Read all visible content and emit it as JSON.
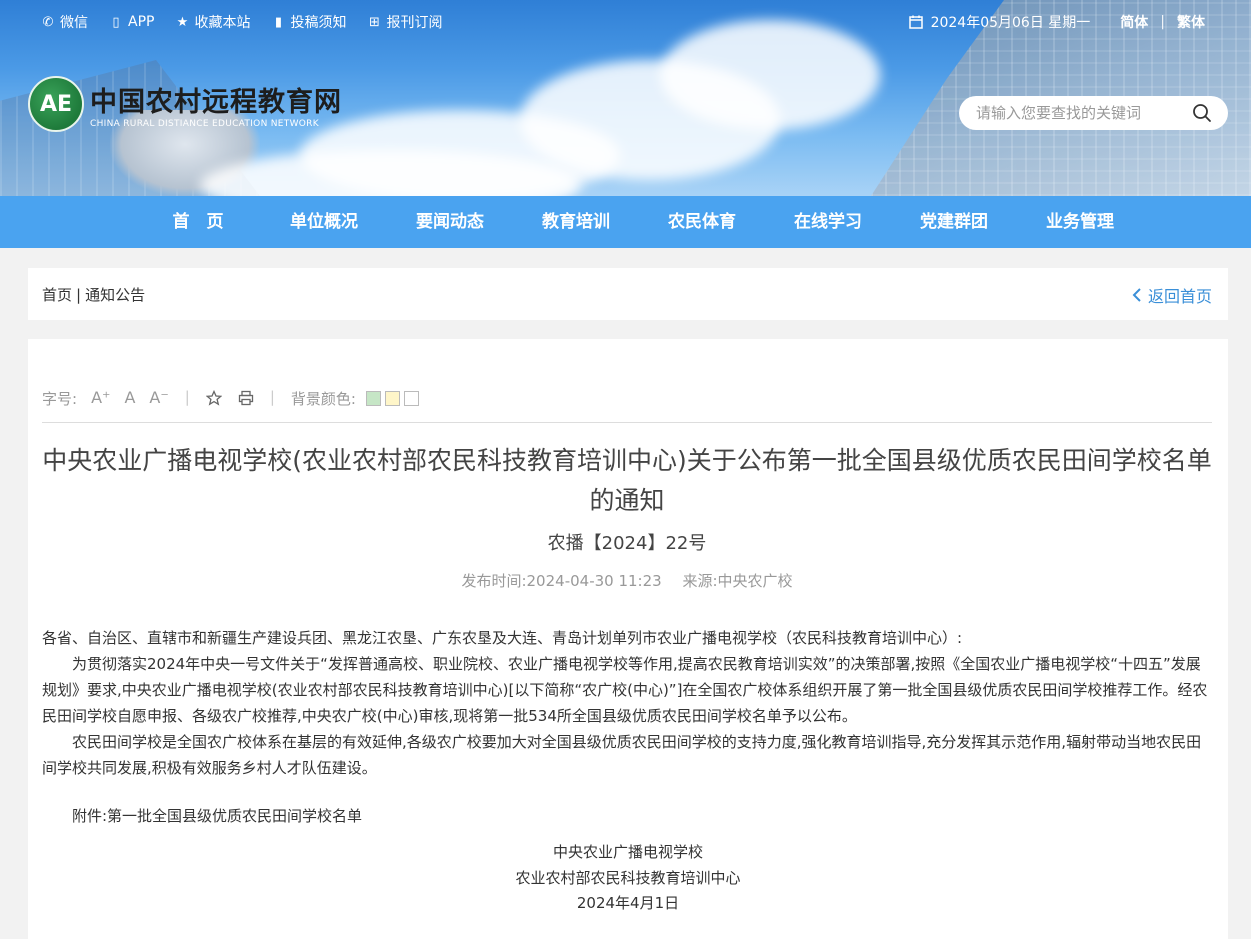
{
  "topbar": {
    "links": [
      {
        "icon": "wechat-icon",
        "glyph": "✆",
        "label": "微信"
      },
      {
        "icon": "phone-icon",
        "glyph": "▯",
        "label": "APP"
      },
      {
        "icon": "star-icon",
        "glyph": "★",
        "label": "收藏本站"
      },
      {
        "icon": "bar-chart-icon",
        "glyph": "▮",
        "label": "投稿须知"
      },
      {
        "icon": "plus-square-icon",
        "glyph": "⊞",
        "label": "报刊订阅"
      }
    ],
    "date": "2024年05月06日 星期一",
    "lang_simplified": "简体",
    "lang_separator": "|",
    "lang_traditional": "繁体"
  },
  "logo": {
    "mark": "AE",
    "cn": "中国农村远程教育网",
    "en": "CHINA RURAL DISTIANCE EDUCATION NETWORK"
  },
  "search": {
    "placeholder": "请输入您要查找的关键词"
  },
  "nav": [
    "首　页",
    "单位概况",
    "要闻动态",
    "教育培训",
    "农民体育",
    "在线学习",
    "党建群团",
    "业务管理"
  ],
  "breadcrumb": {
    "home": "首页",
    "sep": "|",
    "current": "通知公告",
    "back": "返回首页"
  },
  "tools": {
    "font_label": "字号:",
    "font_larger": "A⁺",
    "font_normal": "A",
    "font_smaller": "A⁻",
    "bg_label": "背景颜色:",
    "swatches": [
      "#c6e6c6",
      "#fff6c9",
      "#ffffff"
    ]
  },
  "article": {
    "title": "中央农业广播电视学校(农业农村部农民科技教育培训中心)关于公布第一批全国县级优质农民田间学校名单的通知",
    "doc_no": "农播【2024】22号",
    "publish_label": "发布时间:",
    "publish_time": "2024-04-30 11:23",
    "source_label": "来源:",
    "source": "中央农广校",
    "salutation": "各省、自治区、直辖市和新疆生产建设兵团、黑龙江农垦、广东农垦及大连、青岛计划单列市农业广播电视学校（农民科技教育培训中心）:",
    "para1": "为贯彻落实2024年中央一号文件关于“发挥普通高校、职业院校、农业广播电视学校等作用,提高农民教育培训实效”的决策部署,按照《全国农业广播电视学校“十四五”发展规划》要求,中央农业广播电视学校(农业农村部农民科技教育培训中心)[以下简称“农广校(中心)”]在全国农广校体系组织开展了第一批全国县级优质农民田间学校推荐工作。经农民田间学校自愿申报、各级农广校推荐,中央农广校(中心)审核,现将第一批534所全国县级优质农民田间学校名单予以公布。",
    "para2": "农民田间学校是全国农广校体系在基层的有效延伸,各级农广校要加大对全国县级优质农民田间学校的支持力度,强化教育培训指导,充分发挥其示范作用,辐射带动当地农民田间学校共同发展,积极有效服务乡村人才队伍建设。",
    "attachment": "附件:第一批全国县级优质农民田间学校名单",
    "sign1": "中央农业广播电视学校",
    "sign2": "农业农村部农民科技教育培训中心",
    "sign_date": "2024年4月1日"
  }
}
